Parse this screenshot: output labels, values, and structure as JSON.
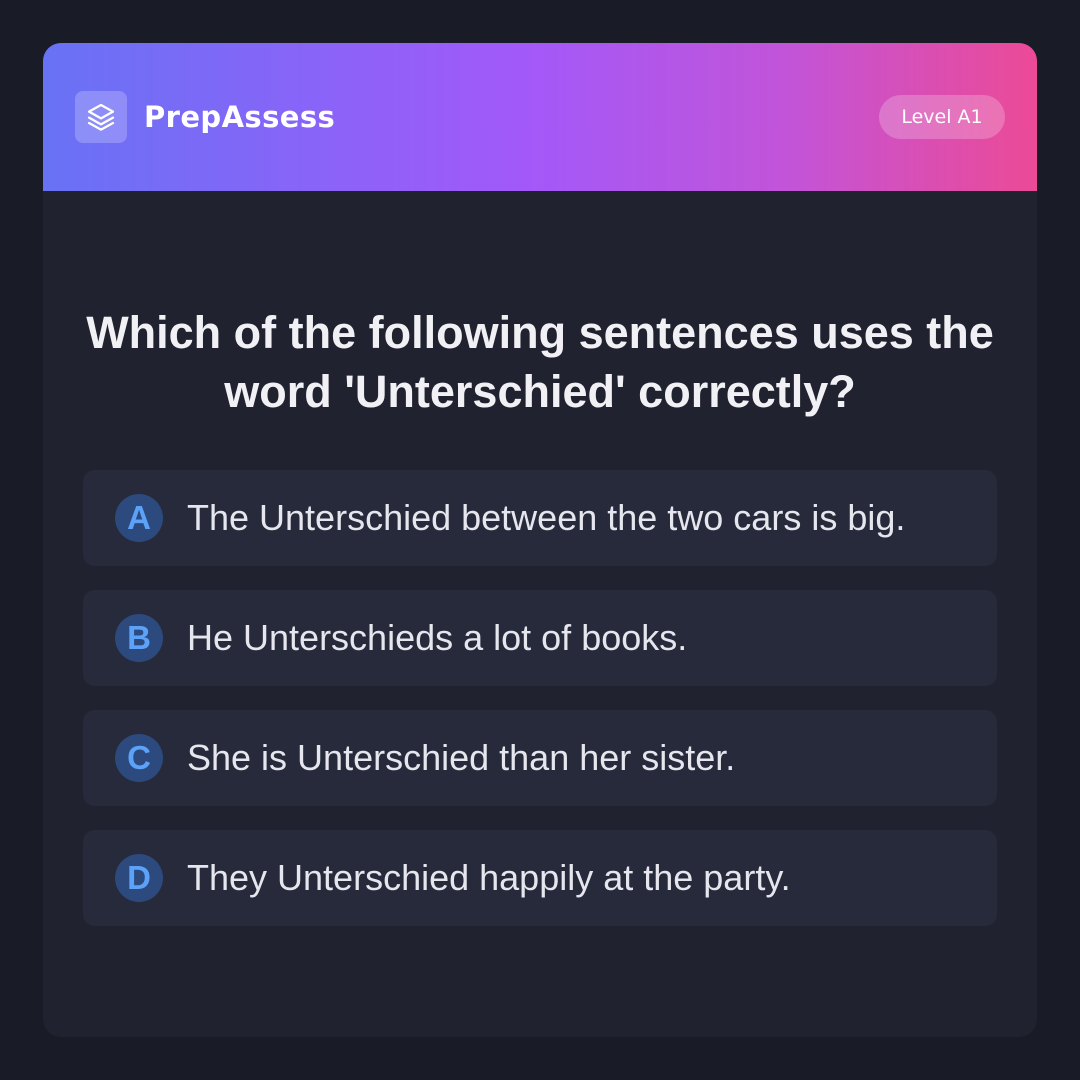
{
  "header": {
    "logo_icon": "layers-icon",
    "brand": "PrepAssess",
    "level": "Level A1"
  },
  "question": "Which of the following sentences uses the word 'Unterschied' correctly?",
  "options": [
    {
      "letter": "A",
      "text": "The Unterschied between the two cars is big."
    },
    {
      "letter": "B",
      "text": "He Unterschieds a lot of books."
    },
    {
      "letter": "C",
      "text": "She is Unterschied than her sister."
    },
    {
      "letter": "D",
      "text": "They Unterschied happily at the party."
    }
  ],
  "colors": {
    "background": "#191b26",
    "card": "#20222f",
    "option_bg": "#272a3a",
    "gradient_start": "#6872f5",
    "gradient_mid": "#a259fa",
    "gradient_end": "#ec4a96",
    "letter_badge_bg": "#2c4a7e",
    "letter_badge_text": "#5ba2f8"
  }
}
